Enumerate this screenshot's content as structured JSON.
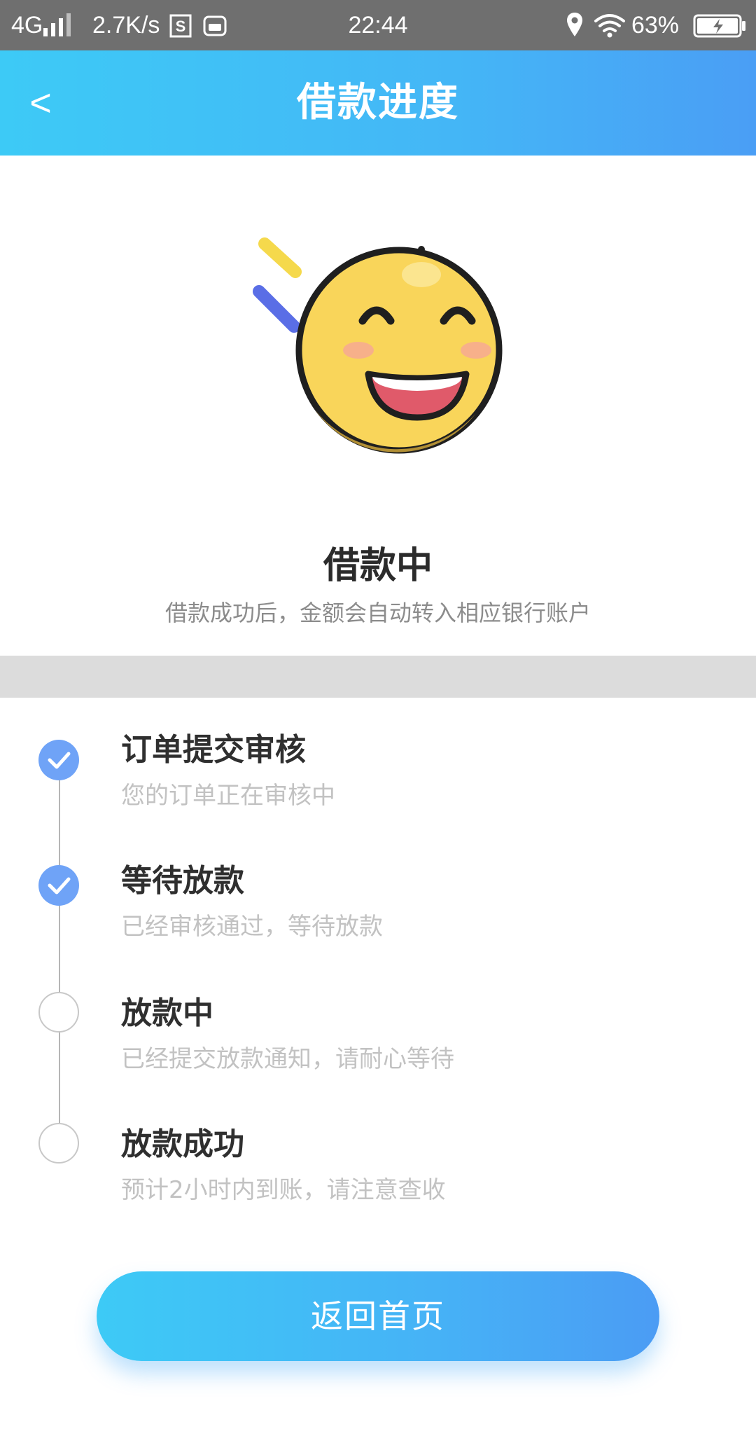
{
  "status_bar": {
    "network_type": "4G",
    "speed": "2.7K/s",
    "time": "22:44",
    "battery_percent": "63%",
    "icons": [
      "signal-icon",
      "storage-s-icon",
      "app-notification-icon",
      "location-icon",
      "wifi-icon",
      "battery-charging-icon"
    ]
  },
  "header": {
    "back_label": "<",
    "title": "借款进度"
  },
  "illustration": {
    "icon": "smiley-face-icon",
    "colors": {
      "face": "#f9d55a",
      "outline": "#1f1f1f",
      "cheek": "#f7b08a",
      "mouth": "#e05a6a",
      "streak_yellow": "#f5d94c",
      "streak_blue": "#5a6ee6"
    }
  },
  "status": {
    "title": "借款中",
    "description": "借款成功后，金额会自动转入相应银行账户"
  },
  "steps": [
    {
      "title": "订单提交审核",
      "description": "您的订单正在审核中",
      "state": "done"
    },
    {
      "title": "等待放款",
      "description": "已经审核通过，等待放款",
      "state": "done"
    },
    {
      "title": "放款中",
      "description": "已经提交放款通知，请耐心等待",
      "state": "pending"
    },
    {
      "title": "放款成功",
      "description": "预计2小时内到账，请注意查收",
      "state": "pending"
    }
  ],
  "home_button": {
    "label": "返回首页"
  },
  "colors": {
    "accent_start": "#3dcaf6",
    "accent_end": "#4a9ef5",
    "step_done": "#6fa3f7",
    "status_bar": "#6f6f6f"
  }
}
